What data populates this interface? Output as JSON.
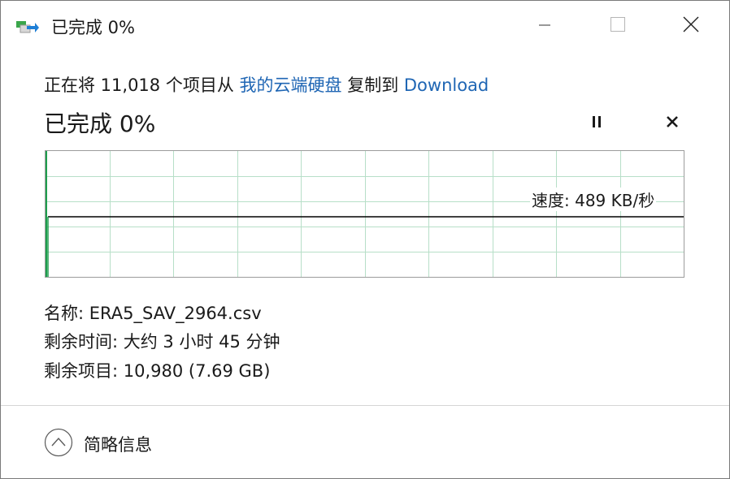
{
  "window": {
    "title": "已完成 0%",
    "icon": "file-copy-icon",
    "controls": {
      "minimize": "minimize-icon",
      "maximize": "maximize-icon",
      "close": "close-icon"
    }
  },
  "copy": {
    "prefix": "正在将 11,018 个项目从 ",
    "source": "我的云端硬盘",
    "middle": " 复制到 ",
    "destination": "Download"
  },
  "progress": {
    "title": "已完成 0%",
    "percent": 0,
    "pause_icon": "pause-icon",
    "stop_icon": "stop-icon"
  },
  "graph": {
    "speed_label": "速度: 489 KB/秒",
    "grid_color": "#b7dfc8",
    "progress_color": "#1e9e4d",
    "speed_line_color": "#000000"
  },
  "details": {
    "name": "名称: ERA5_SAV_2964.csv",
    "time_remaining": "剩余时间: 大约 3 小时 45 分钟",
    "items_remaining": "剩余项目: 10,980 (7.69 GB)"
  },
  "footer": {
    "toggle_label": "简略信息",
    "toggle_icon": "chevron-up-icon"
  },
  "colors": {
    "link": "#1f66b4"
  }
}
